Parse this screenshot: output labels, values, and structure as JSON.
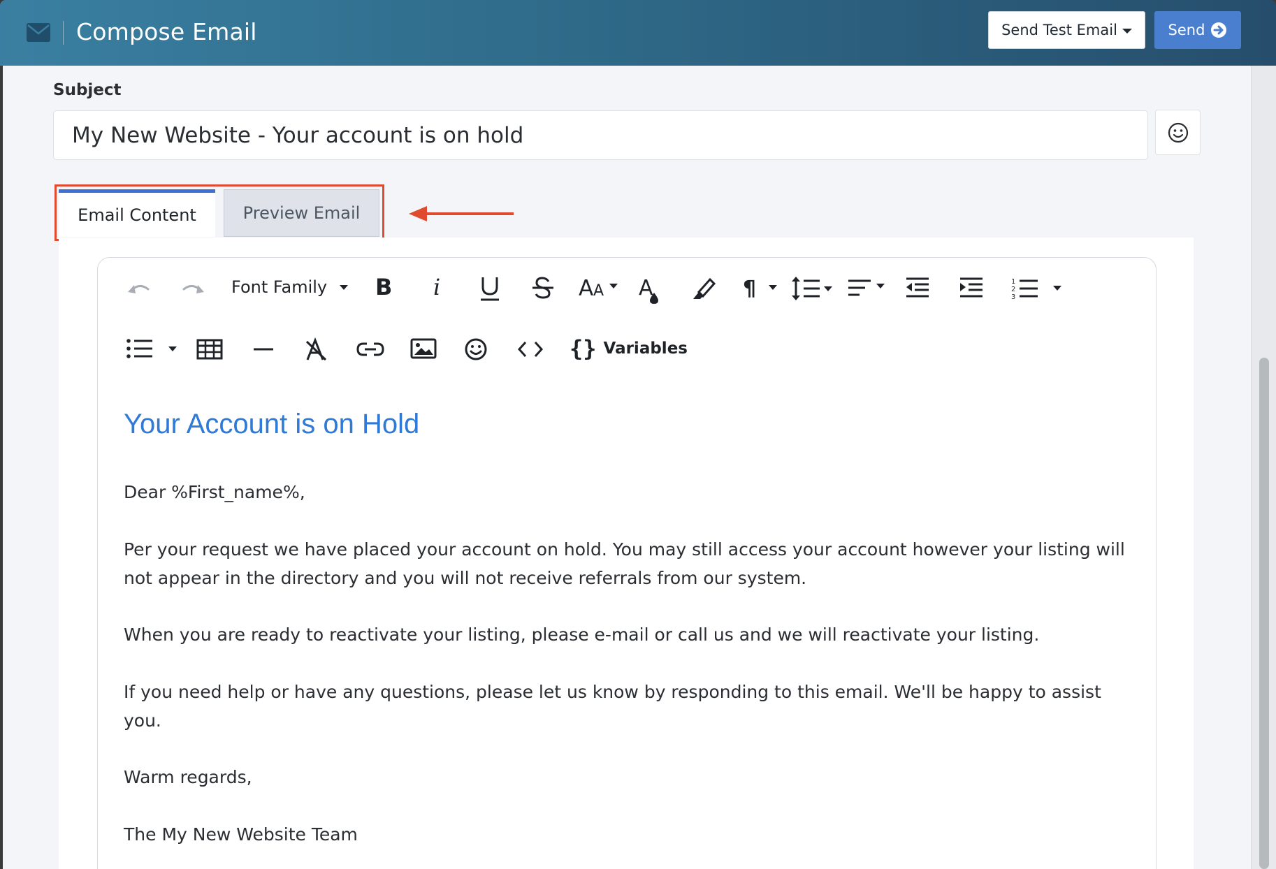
{
  "header": {
    "title": "Compose Email",
    "send_test_label": "Send Test Email",
    "send_label": "Send"
  },
  "subject": {
    "label": "Subject",
    "value": "My New Website - Your account is on hold"
  },
  "tabs": [
    {
      "label": "Email Content",
      "active": true
    },
    {
      "label": "Preview Email",
      "active": false
    }
  ],
  "toolbar": {
    "font_family_label": "Font Family",
    "variables_label": "Variables",
    "row1": [
      "undo-icon",
      "redo-icon",
      "font-family-dropdown",
      "bold-icon",
      "italic-icon",
      "underline-icon",
      "strikethrough-icon",
      "font-size-icon",
      "text-color-icon",
      "highlight-icon",
      "paragraph-format-icon",
      "line-height-icon",
      "align-icon",
      "outdent-icon",
      "indent-icon",
      "ordered-list-icon"
    ],
    "row2": [
      "unordered-list-icon",
      "table-icon",
      "horizontal-line-icon",
      "clear-formatting-icon",
      "link-icon",
      "image-icon",
      "emoji-icon",
      "code-view-icon",
      "variables-icon"
    ]
  },
  "email_body": {
    "heading": "Your Account is on Hold",
    "paragraphs": [
      "Dear %First_name%,",
      "Per your request we have placed your account on hold. You may still access your account however your listing will not appear in the directory and you will not receive referrals from our system.",
      "When you are ready to reactivate your listing, please e-mail or call us and we will reactivate your listing.",
      "If you need help or have any questions, please let us know by responding to this email. We'll be happy to assist you.",
      "Warm regards,",
      "The My New Website Team"
    ]
  },
  "colors": {
    "header_gradient_start": "#3a7fa1",
    "header_gradient_end": "#264e6c",
    "send_button": "#4a7fd0",
    "heading_blue": "#2f7ad6",
    "annotation_red": "#e04a2f",
    "active_tab_border": "#3e6fd6"
  }
}
